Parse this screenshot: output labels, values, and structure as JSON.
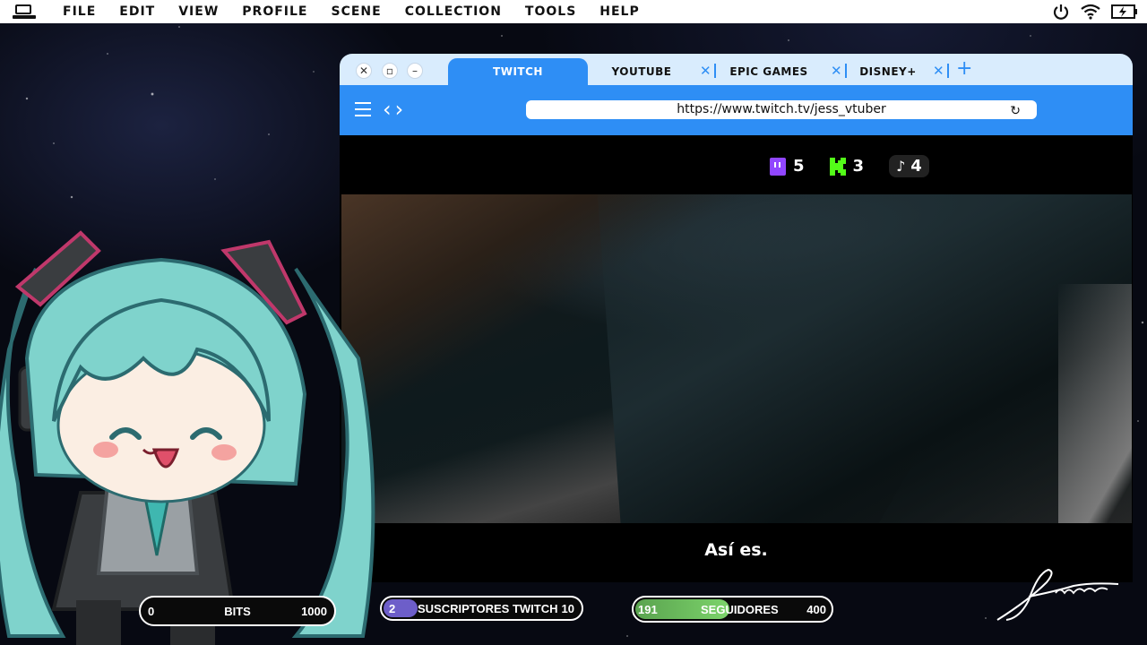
{
  "menubar": {
    "items": [
      "FILE",
      "EDIT",
      "VIEW",
      "PROFILE",
      "SCENE",
      "COLLECTION",
      "TOOLS",
      "HELP"
    ]
  },
  "browser": {
    "tabs": [
      {
        "label": "TWITCH",
        "active": true
      },
      {
        "label": "YOUTUBE",
        "active": false
      },
      {
        "label": "EPIC GAMES",
        "active": false
      },
      {
        "label": "DISNEY+",
        "active": false
      }
    ],
    "url": "https://www.twitch.tv/jess_vtuber",
    "counters": {
      "twitch": "5",
      "kick": "3",
      "tiktok": "4"
    },
    "subtitle": "Así es."
  },
  "goals": {
    "bits": {
      "min": "0",
      "label": "BITS",
      "max": "1000",
      "progress": 0.0
    },
    "subs": {
      "min": "2",
      "label": "SUSCRIPTORES TWITCH",
      "max": "10",
      "progress": 0.2
    },
    "followers": {
      "min": "191",
      "label": "SEGUIDORES",
      "max": "400",
      "progress": 0.48
    }
  },
  "colors": {
    "accent": "#2e8ef5",
    "tabbar": "#d9ecfd",
    "twitch": "#9146ff",
    "kick": "#53fc18"
  },
  "signature_text": "Jess Vtuber"
}
